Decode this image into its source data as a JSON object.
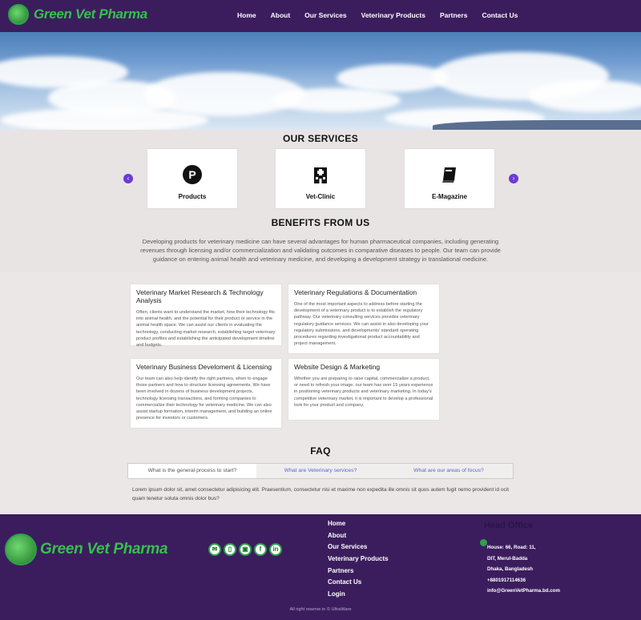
{
  "brand": {
    "name": "Green Vet Pharma",
    "accent": "#34c24a",
    "nav_bg": "#3b1d5e"
  },
  "nav": {
    "links": [
      "Home",
      "About",
      "Our Services",
      "Veterinary Products",
      "Partners",
      "Contact Us"
    ]
  },
  "services": {
    "title": "OUR SERVICES",
    "cards": [
      {
        "label": "Products",
        "icon": "parking-icon"
      },
      {
        "label": "Vet-Clinic",
        "icon": "hospital-icon"
      },
      {
        "label": "E-Magazine",
        "icon": "book-icon"
      }
    ],
    "prev": "‹",
    "next": "›"
  },
  "benefits": {
    "title": "BENEFITS FROM US",
    "text": "Developing products for veterinary medicine can have several advantages for human pharmaceutical companies, including generating revenues through licensing and/or commercialization and validating outcomes in comparative diseases to people. Our team can provide guidance on entering animal health and veterinary medicine, and developing a development strategy in translational medicine.",
    "boxes": [
      {
        "title": "Veterinary Market Research & Technology Analysis",
        "text": "Often, clients want to understand the market, how their technology fits into animal health, and the potential for their product or service in the animal health space. We can assist our clients in evaluating the technology, conducting market research, establishing target veterinary product profiles and establishing the anticipated development timeline and budgets."
      },
      {
        "title": "Veterinary Regulations & Documentation",
        "text": "One of the most important aspects to address before starting the development of a veterinary product is to establish the regulatory pathway. Our veterinary consulting services provides veterinary regulatory guidance services. We can assist in also developing your regulatory submissions, and developments' standard operating procedures regarding investigational product accountability and project management."
      },
      {
        "title": "Veterinary Business Develoment & Licensing",
        "text": "Our team can also help identify the right partners, when to engage those partners and how to structure licensing agreements. We have been involved in dozens of business development projects, technology licensing transactions, and forming companies to commercialize their technology for veterinary medicine. We can also assist startup formation, interim management, and building an online presence for investors or customers."
      },
      {
        "title": "Website Design & Marketing",
        "text": "Whether you are preparing to raise capital, commercialize a product, or need to refresh your image, our team has over 15 years experience in positioning veterinary products and veterinary marketing. In today's competitive veterinary market, it is important to develop a professional look for your product and company."
      }
    ]
  },
  "faq": {
    "title": "FAQ",
    "tabs": [
      "What is the general process to start?",
      "What are Veterinary services?",
      "What are our areas of focus?"
    ],
    "answer": "Lorem ipsum dolor sit, amet consectetur adipisicing elit. Praesentium, consectetur nisi et maxime non expedita ille omnis sit quos autem fugit nemo provident id ocit quam tenetur soluta omnis dolor bus?"
  },
  "footer": {
    "socials": [
      "✉",
      "▯",
      "▣",
      "f",
      "in"
    ],
    "links": [
      "Home",
      "About",
      "Our Services",
      "Veterinary Products",
      "Partners",
      "Contact Us",
      "Login"
    ],
    "office_title": "Head Office",
    "office": [
      "House: 66, Road: 11,",
      "DIT, Merul-Badda",
      "Dhaka, Bangladesh",
      "+8801917114636",
      "info@GreenVetPharma.bd.com"
    ],
    "copyright": "All right reserve in © UltraWare"
  }
}
